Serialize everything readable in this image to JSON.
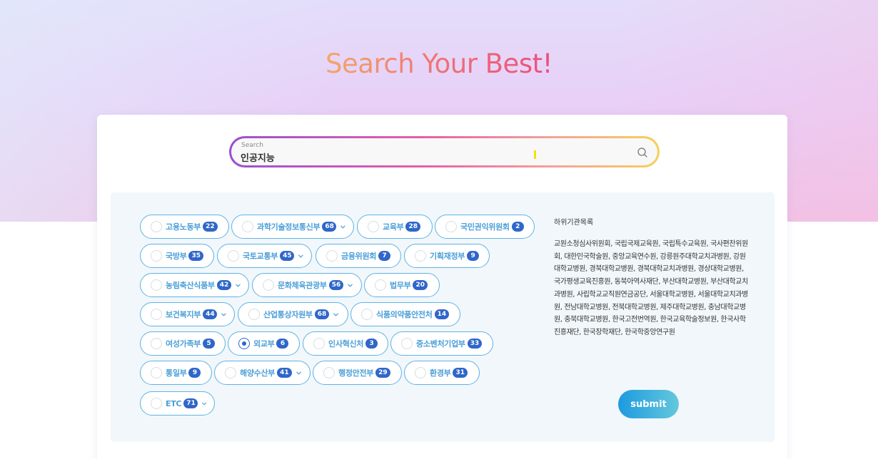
{
  "hero": {
    "title": "Search Your Best!"
  },
  "search": {
    "label": "Search",
    "value": "인공지능",
    "icon": "search-icon"
  },
  "ministries": [
    {
      "label": "고용노동부",
      "count": "22",
      "checked": false,
      "expandable": false
    },
    {
      "label": "과학기술정보통신부",
      "count": "68",
      "checked": false,
      "expandable": true
    },
    {
      "label": "교육부",
      "count": "28",
      "checked": false,
      "expandable": false
    },
    {
      "label": "국민권익위원회",
      "count": "2",
      "checked": false,
      "expandable": false
    },
    {
      "label": "국방부",
      "count": "35",
      "checked": false,
      "expandable": false
    },
    {
      "label": "국토교통부",
      "count": "45",
      "checked": false,
      "expandable": true
    },
    {
      "label": "금융위원회",
      "count": "7",
      "checked": false,
      "expandable": false
    },
    {
      "label": "기획재정부",
      "count": "9",
      "checked": false,
      "expandable": false
    },
    {
      "label": "농림축산식품부",
      "count": "42",
      "checked": false,
      "expandable": true
    },
    {
      "label": "문화체육관광부",
      "count": "56",
      "checked": false,
      "expandable": true
    },
    {
      "label": "법무부",
      "count": "20",
      "checked": false,
      "expandable": false
    },
    {
      "label": "보건복지부",
      "count": "44",
      "checked": false,
      "expandable": true
    },
    {
      "label": "산업통상자원부",
      "count": "68",
      "checked": false,
      "expandable": true
    },
    {
      "label": "식품의약품안전처",
      "count": "14",
      "checked": false,
      "expandable": false
    },
    {
      "label": "여성가족부",
      "count": "5",
      "checked": false,
      "expandable": false
    },
    {
      "label": "외교부",
      "count": "6",
      "checked": true,
      "expandable": false
    },
    {
      "label": "인사혁신처",
      "count": "3",
      "checked": false,
      "expandable": false
    },
    {
      "label": "중소벤처기업부",
      "count": "33",
      "checked": false,
      "expandable": false
    },
    {
      "label": "통일부",
      "count": "9",
      "checked": false,
      "expandable": false
    },
    {
      "label": "해양수산부",
      "count": "41",
      "checked": false,
      "expandable": true
    },
    {
      "label": "행정안전부",
      "count": "29",
      "checked": false,
      "expandable": false
    },
    {
      "label": "환경부",
      "count": "31",
      "checked": false,
      "expandable": false
    },
    {
      "label": "ETC",
      "count": "71",
      "checked": false,
      "expandable": true
    }
  ],
  "sub_agencies": {
    "title": "하위기관목록",
    "body": "교원소청심사위원회, 국립국제교육원, 국립특수교육원, 국사편찬위원회, 대한민국학술원, 중앙교육연수원, 강릉원주대학교치과병원, 강원대학교병원, 경북대학교병원, 경북대학교치과병원, 경상대학교병원, 국가평생교육진흥원, 동북아역사재단, 부산대학교병원, 부산대학교치과병원, 사립학교교직원연금공단, 서울대학교병원, 서울대학교치과병원, 전남대학교병원, 전북대학교병원, 제주대학교병원, 충남대학교병원, 충북대학교병원, 한국고전번역원, 한국교육학술정보원, 한국사학진흥재단, 한국장학재단, 한국학중앙연구원"
  },
  "submit": {
    "label": "submit"
  },
  "colors": {
    "chip_border": "#5fb3e4",
    "chip_text": "#4a9fd8",
    "badge_bg": "#2f66c9",
    "submit_start": "#1d9ae0",
    "submit_end": "#63c8dc"
  }
}
